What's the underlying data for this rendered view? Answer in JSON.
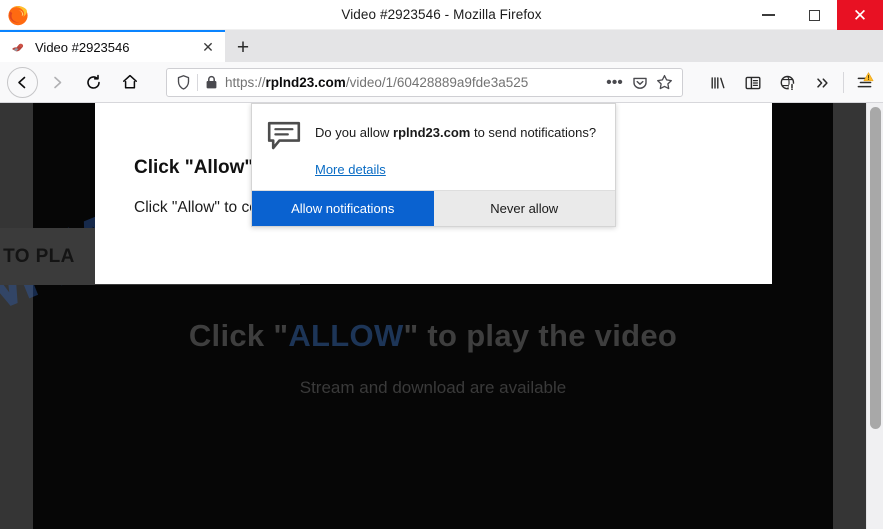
{
  "window": {
    "title": "Video #2923546 - Mozilla Firefox",
    "minimize_label": "Minimize",
    "maximize_label": "Maximize",
    "close_label": "Close"
  },
  "tabs": {
    "active": {
      "title": "Video #2923546",
      "close_glyph": "✕"
    },
    "new_tab_glyph": "+"
  },
  "toolbar": {
    "back_glyph": "←",
    "forward_glyph": "→",
    "reload_glyph": "↻",
    "home_glyph": "⌂",
    "page_actions_glyph": "•••",
    "pocket_label": "Save to Pocket",
    "bookmark_glyph": "☆",
    "library_label": "Library",
    "sidebar_label": "Sidebar",
    "account_label": "Account",
    "overflow_glyph": "»",
    "menu_label": "Open menu"
  },
  "urlbar": {
    "scheme": "https://",
    "host": "rplnd23.com",
    "path": "/video/1/60428889a9fde3a525",
    "full_url": "https://rplnd23.com/video/1/60428889a9fde3a525"
  },
  "page": {
    "card": {
      "title": "Click \"Allow\"",
      "body": "Click \"Allow\" to continue, then click on detailed information"
    },
    "banner_fragment": "\" TO PLA",
    "video": {
      "headline_before": "Click \"",
      "headline_allow": "ALLOW",
      "headline_after": "\" to play the video",
      "subline": "Stream and download are available"
    },
    "watermark": "MYANTISPYWARE.COM"
  },
  "notification_dialog": {
    "question_prefix": "Do you allow ",
    "question_domain": "rplnd23.com",
    "question_suffix": " to send notifications?",
    "more_details": "More details",
    "allow_label": "Allow notifications",
    "never_label": "Never allow"
  },
  "colors": {
    "accent_blue": "#0a62d0",
    "tab_highlight": "#0a84ff",
    "close_red": "#e81123",
    "link_blue": "#0a6cc4",
    "watermark_blue": "#2f5fb0",
    "page_dark": "#060606",
    "chrome_grey": "#f9f9fa"
  },
  "scrollbar": {
    "orientation": "vertical"
  }
}
